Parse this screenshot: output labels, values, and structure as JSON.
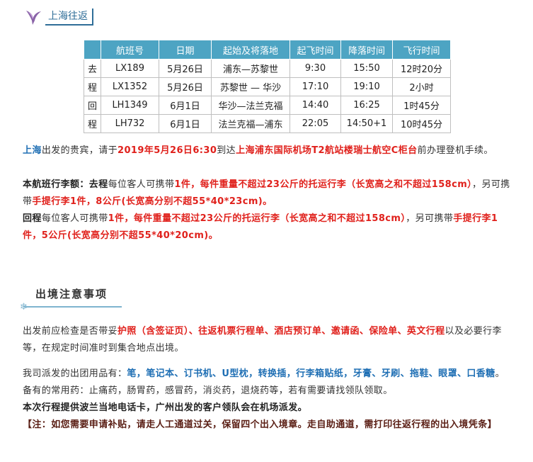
{
  "header": {
    "title": "上海往返"
  },
  "flights": {
    "headers": [
      "航班号",
      "日期",
      "起始及将落地",
      "起飞时间",
      "降落时间",
      "飞行时间"
    ],
    "groups": [
      {
        "label": [
          "去",
          "程"
        ],
        "rows": [
          [
            "LX189",
            "5月26日",
            "浦东—苏黎世",
            "9:30",
            "15:50",
            "12时20分"
          ],
          [
            "LX1352",
            "5月26日",
            "苏黎世 — 华沙",
            "17:10",
            "19:10",
            "2小时"
          ]
        ]
      },
      {
        "label": [
          "回",
          "程"
        ],
        "rows": [
          [
            "LH1349",
            "6月1日",
            "华沙—法兰克福",
            "14:40",
            "16:25",
            "1时45分"
          ],
          [
            "LH732",
            "6月1日",
            "法兰克福—浦东",
            "22:05",
            "14:50+1",
            "10时45分"
          ]
        ]
      }
    ]
  },
  "intro": {
    "s1": "上海",
    "s2": "出发的贵宾，请于",
    "s3": "2019年5月26日6:30",
    "s4": "到达",
    "s5": "上海浦东国际机场T2航站楼瑞士航空C柜台",
    "s6": "前办理登机手续。"
  },
  "baggage_go": {
    "s1": "本航班行李额：去程",
    "s2": "每位客人可携带",
    "s3": "1件，每件重量不超过23公斤的托运行李（长宽高之和不超过158cm）",
    "s4": "，另可携带",
    "s5": "手提行李1件，8公斤(长宽高分别不超55*40*23cm)。"
  },
  "baggage_return": {
    "s1": "回程",
    "s2": "每位客人可携带",
    "s3": "1件，每件重量不超过23公斤的托运行李（长宽高之和不超过158cm）",
    "s4": "，另可携带",
    "s5": "手提行李1件，5公斤(长宽高分别不超55*40*20cm)。"
  },
  "notice": {
    "title": "出境注意事项"
  },
  "check": {
    "s1": "出发前应检查是否带妥",
    "s2": "护照（含签证页）、往返机票行程单、酒店预订单、邀请函、保险单、英文行程",
    "s3": "以及必要行李等，在规定时间准时到集合地点出境。"
  },
  "supplies": {
    "s1": "我司派发的出团用品有：",
    "s2": "笔，笔记本、订书机、U型枕，转换插，行李箱贴纸，牙膏、牙刷、拖鞋、眼罩、口香糖",
    "s3": "。备有的常用药：止痛药，肠胃药，感冒药，消炎药，退烧药等，若有需要请找领队领取。"
  },
  "phonecard": "本次行程提供波兰当地电话卡，广州出发的客户领队会在机场派发。",
  "note": "【注：如您需要申请补贴，请走人工通道过关，保留四个出入境章。走自助通道，需打印往返行程的出入境凭条】",
  "colors": {
    "accent_blue": "#1f6fb4",
    "highlight_red": "#e0211c",
    "note_dark_red": "#5a1e14",
    "table_header": "#4da4c3"
  }
}
